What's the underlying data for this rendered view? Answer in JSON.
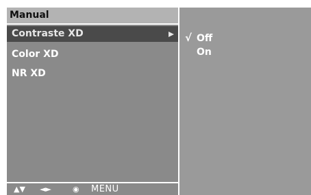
{
  "menu": {
    "title": "Manual",
    "items": [
      {
        "label": "Contraste XD",
        "selected": true
      },
      {
        "label": "Color XD",
        "selected": false
      },
      {
        "label": "NR XD",
        "selected": false
      }
    ]
  },
  "options": {
    "checkmark": "√",
    "items": [
      {
        "label": "Off",
        "checked": true
      },
      {
        "label": "On",
        "checked": false
      }
    ]
  },
  "navigation": {
    "up_down_icon": "▲▼",
    "left_right_icon": "◄►",
    "ok_icon": "◉",
    "menu_label": "MENU"
  },
  "colors": {
    "panel_left": "#8a8a8a",
    "panel_right": "#9a9a9a",
    "title_bar": "#b3b3b3",
    "selected_row": "#4a4a4a",
    "text": "#ffffff"
  }
}
